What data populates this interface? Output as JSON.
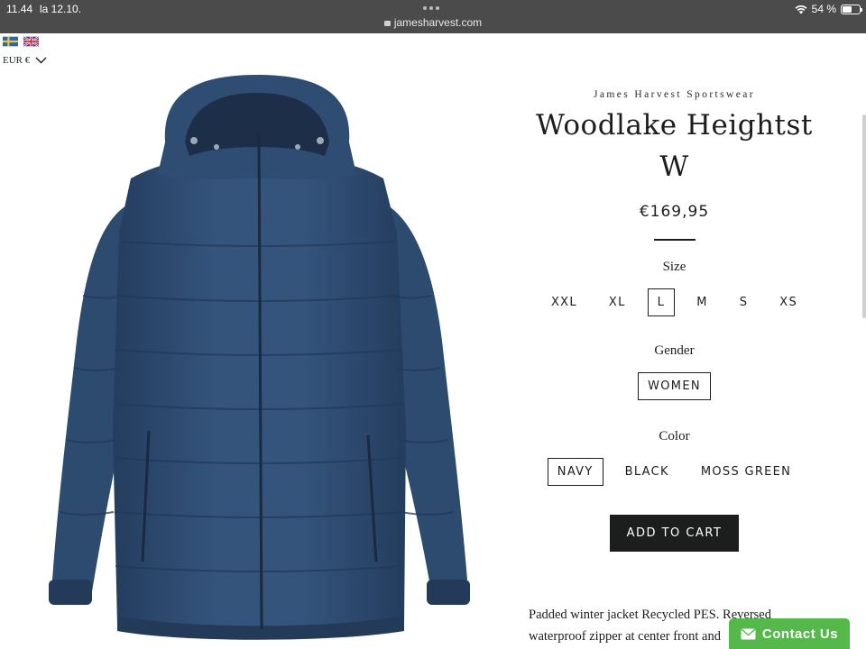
{
  "status_bar": {
    "time": "11.44",
    "date": "la 12.10.",
    "url": "jamesharvest.com",
    "battery_text": "54 %",
    "battery_level": 0.54
  },
  "header": {
    "flags": [
      "swedish-flag",
      "uk-flag"
    ],
    "currency": "EUR €"
  },
  "product": {
    "vendor": "James Harvest Sportswear",
    "title": "Woodlake Heightst W",
    "price": "€169,95",
    "size_label": "Size",
    "sizes": [
      "XXL",
      "XL",
      "L",
      "M",
      "S",
      "XS"
    ],
    "selected_size": "L",
    "gender_label": "Gender",
    "genders": [
      "WOMEN"
    ],
    "color_label": "Color",
    "colors": [
      "NAVY",
      "BLACK",
      "MOSS GREEN"
    ],
    "selected_color": "NAVY",
    "add_to_cart": "ADD TO CART",
    "description": "Padded winter jacket Recycled PES. Reversed waterproof zipper at center front and"
  },
  "contact": {
    "label": "Contact Us",
    "color": "#54b94a"
  },
  "colors": {
    "status_bar_bg": "#4b4b4b",
    "text": "#1c1d1d",
    "jacket_navy": "#2e4a6e"
  }
}
